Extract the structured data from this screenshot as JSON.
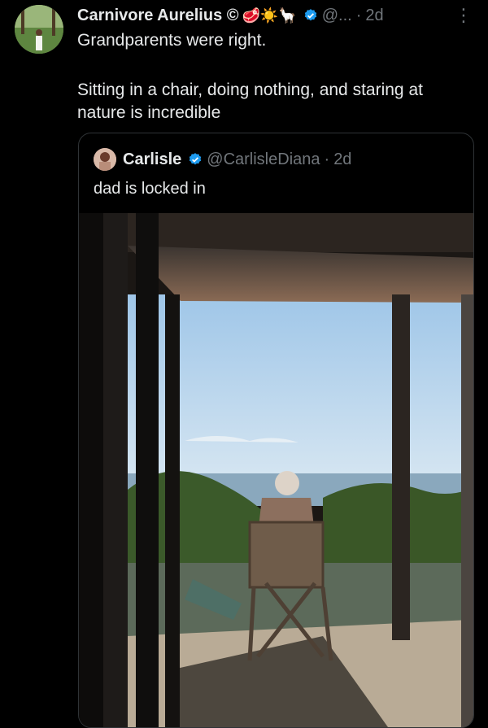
{
  "tweet": {
    "author_name": "Carnivore Aurelius ©",
    "author_emoji": "🥩☀️🦙",
    "handle": "@...",
    "dot": "·",
    "time": "2d",
    "more": "⋮",
    "text_line1": "Grandparents were right.",
    "text_line2": "Sitting in a chair, doing nothing, and staring at nature is incredible"
  },
  "quote": {
    "author_name": "Carlisle",
    "handle": "@CarlisleDiana",
    "dot": "·",
    "time": "2d",
    "text": "dad is locked in",
    "photo_icon": "photo-man-in-chair"
  },
  "colors": {
    "background": "#000000",
    "text": "#e7e9ea",
    "muted": "#71767b",
    "verified": "#1d9bf0",
    "border": "#2f3336"
  }
}
